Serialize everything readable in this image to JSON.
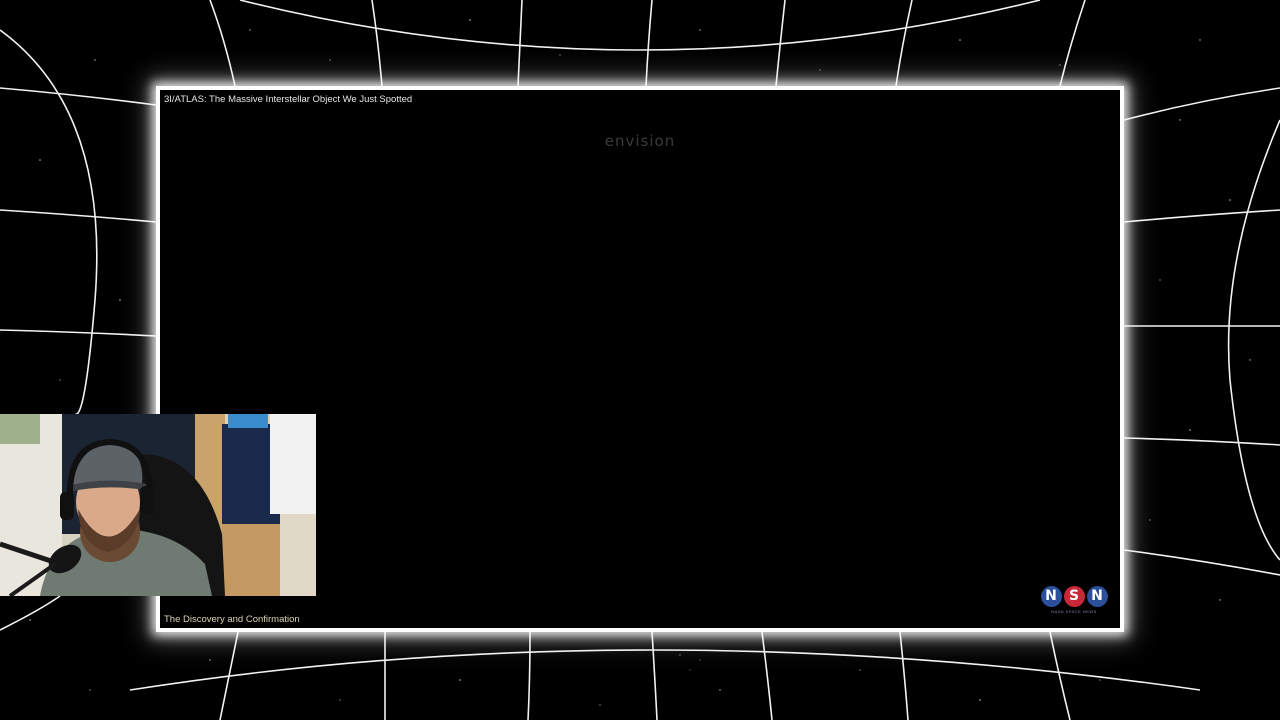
{
  "video": {
    "title": "3I/ATLAS: The Massive Interstellar Object We Just Spotted",
    "brand_watermark": "envision",
    "chapter": "The Discovery and Confirmation"
  },
  "channel_logo": {
    "letters": [
      "N",
      "S",
      "N"
    ],
    "subtitle": "NASA SPACE NEWS",
    "colors": {
      "outer_letter_bg": "#2b4f9a",
      "center_letter_bg": "#c8283a"
    }
  },
  "webcam": {
    "name": "webcam-overlay"
  },
  "colors": {
    "background": "#000000",
    "grid_lines": "#ffffff",
    "frame_border": "#ffffff"
  }
}
